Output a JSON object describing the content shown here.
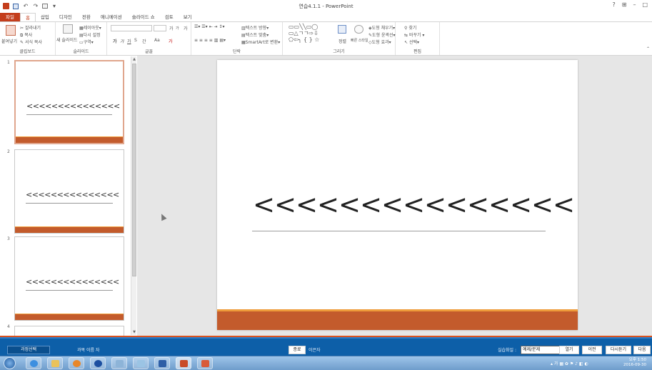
{
  "window": {
    "title": "연습4.1.1 - PowerPoint",
    "controls": {
      "help": "?",
      "ribbon_options": "⊞",
      "minimize": "–",
      "restore": "□"
    },
    "quick_access": {
      "save_icon": "floppy-icon",
      "undo": "↶",
      "redo": "↷",
      "customize": "▾"
    }
  },
  "tabs": [
    "파일",
    "홈",
    "삽입",
    "디자인",
    "전환",
    "애니메이션",
    "슬라이드 쇼",
    "검토",
    "보기"
  ],
  "active_tab": "홈",
  "ribbon": {
    "clipboard": {
      "label": "클립보드",
      "paste": "붙여넣기",
      "cut": "잘라내기",
      "copy": "복사",
      "format_painter": "서식 복사"
    },
    "slides": {
      "label": "슬라이드",
      "new_slide": "새 슬라이드",
      "layout": "레이아웃",
      "reset": "다시 설정",
      "section": "구역"
    },
    "font": {
      "label": "글꼴",
      "bold": "가",
      "italic": "가",
      "underline": "가",
      "strike": "S",
      "spacing": "간",
      "case": "Aa",
      "color": "가",
      "grow": "가",
      "shrink": "가",
      "clear": "가"
    },
    "paragraph": {
      "label": "단락",
      "text_direction": "텍스트 방향",
      "align_text": "텍스트 맞춤",
      "smartart": "SmartArt로 변환"
    },
    "drawing": {
      "label": "그리기",
      "arrange": "정렬",
      "quick_styles": "빠른 스타일",
      "shape_fill": "도형 채우기",
      "shape_outline": "도형 윤곽선",
      "shape_effects": "도형 효과"
    },
    "editing": {
      "label": "편집",
      "find": "찾기",
      "replace": "바꾸기",
      "select": "선택"
    }
  },
  "slides": [
    {
      "number": "1",
      "title": "<<<<<<<<<<<<<<<"
    },
    {
      "number": "2",
      "title": "<<<<<<<<<<<<<<<"
    },
    {
      "number": "3",
      "title": "<<<<<<<<<<<<<<<"
    },
    {
      "number": "4",
      "title": ""
    }
  ],
  "selected_slide": "1",
  "main_slide": {
    "title": "<<<<<<<<<<<<<<<"
  },
  "lms_bar": {
    "process_select": "과정선택",
    "course_name": "과목 이름 자",
    "end_button": "종료",
    "user_name": "이은자",
    "practice_label": "실습화일 :",
    "practice_value": "예제/문제",
    "open_button": "열기",
    "prev_button": "이전",
    "listen_again_button": "다시듣기",
    "next_button": "다음"
  },
  "taskbar": {
    "apps": [
      "start-orb-icon",
      "ie-icon",
      "explorer-icon",
      "media-icon",
      "chrome-icon",
      "search-app-icon",
      "paint-icon",
      "word-icon",
      "powerpoint-icon",
      "powerpoint-doc-icon"
    ],
    "tray_lang": "가",
    "clock_time": "오후 1:50",
    "clock_date": "2016-09-30"
  },
  "colors": {
    "accent": "#c43e1c",
    "slide_bar": "#c35b2c",
    "slide_bar_top": "#ee9b3a",
    "lms_bar": "#0d5fa8"
  }
}
